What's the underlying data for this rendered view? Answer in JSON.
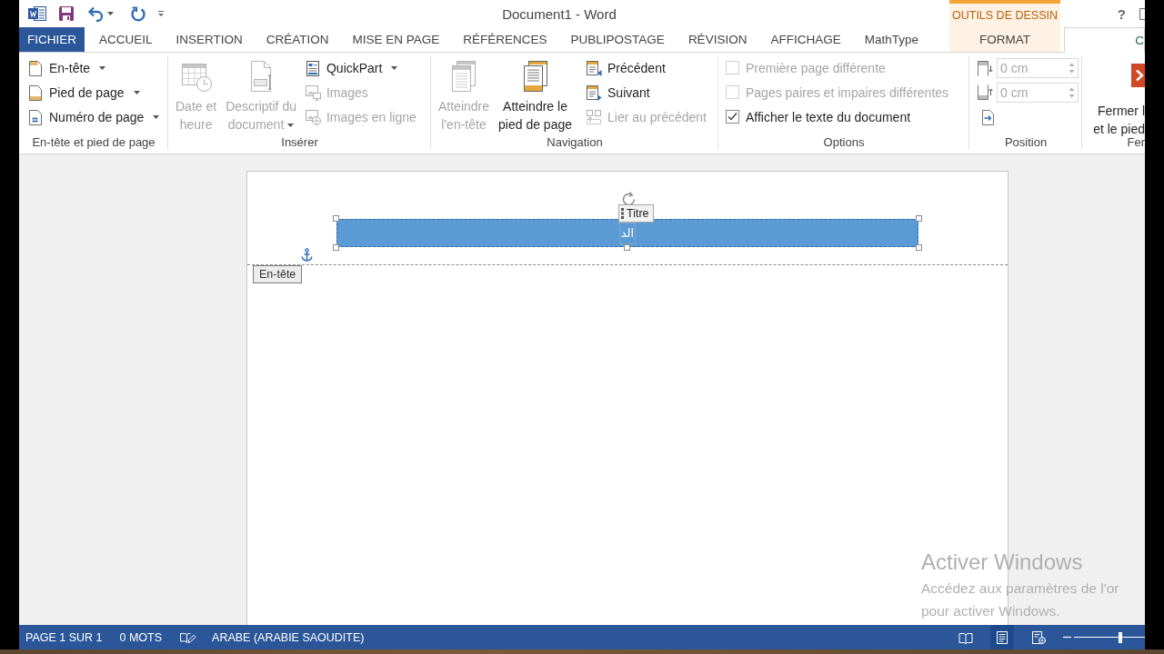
{
  "window": {
    "title": "Document1 - Word",
    "help": "?"
  },
  "contextual_group": {
    "label": "OUTILS DE DESSIN"
  },
  "tabs": [
    {
      "label": "FICHIER",
      "kind": "file",
      "selected": false
    },
    {
      "label": "ACCUEIL",
      "kind": "standard",
      "selected": false
    },
    {
      "label": "INSERTION",
      "kind": "standard",
      "selected": false
    },
    {
      "label": "CRÉATION",
      "kind": "standard",
      "selected": false
    },
    {
      "label": "MISE EN PAGE",
      "kind": "standard",
      "selected": false
    },
    {
      "label": "RÉFÉRENCES",
      "kind": "standard",
      "selected": false
    },
    {
      "label": "PUBLIPOSTAGE",
      "kind": "standard",
      "selected": false
    },
    {
      "label": "RÉVISION",
      "kind": "standard",
      "selected": false
    },
    {
      "label": "AFFICHAGE",
      "kind": "standard",
      "selected": false
    },
    {
      "label": "MathType",
      "kind": "standard",
      "selected": false
    },
    {
      "label": "FORMAT",
      "kind": "contextual",
      "selected": false
    },
    {
      "label": "C",
      "kind": "contextual",
      "selected": true
    }
  ],
  "ribbon": {
    "groups": [
      {
        "label": "En-tête et pied de page",
        "items": [
          {
            "kind": "small",
            "label": "En-tête",
            "dropdown": true,
            "disabled": false
          },
          {
            "kind": "small",
            "label": "Pied de page",
            "dropdown": true,
            "disabled": false
          },
          {
            "kind": "small",
            "label": "Numéro de page",
            "dropdown": true,
            "disabled": false
          }
        ]
      },
      {
        "label": "Insérer",
        "items": [
          {
            "kind": "large",
            "label": "Date et\nheure",
            "dropdown": false,
            "disabled": true
          },
          {
            "kind": "large",
            "label": "Descriptif du\ndocument",
            "dropdown": true,
            "disabled": true
          },
          {
            "kind": "small",
            "label": "QuickPart",
            "dropdown": true,
            "disabled": false
          },
          {
            "kind": "small",
            "label": "Images",
            "dropdown": false,
            "disabled": true
          },
          {
            "kind": "small",
            "label": "Images en ligne",
            "dropdown": false,
            "disabled": true
          }
        ]
      },
      {
        "label": "Navigation",
        "items": [
          {
            "kind": "large",
            "label": "Atteindre\nl'en-tête",
            "dropdown": false,
            "disabled": true
          },
          {
            "kind": "large",
            "label": "Atteindre le\npied de page",
            "dropdown": false,
            "disabled": false
          },
          {
            "kind": "small",
            "label": "Précédent",
            "dropdown": false,
            "disabled": false
          },
          {
            "kind": "small",
            "label": "Suivant",
            "dropdown": false,
            "disabled": false
          },
          {
            "kind": "small",
            "label": "Lier au précédent",
            "dropdown": false,
            "disabled": true
          }
        ]
      },
      {
        "label": "Options",
        "items": [
          {
            "kind": "checkbox",
            "label": "Première page différente",
            "checked": false,
            "disabled": true
          },
          {
            "kind": "checkbox",
            "label": "Pages paires et impaires différentes",
            "checked": false,
            "disabled": true
          },
          {
            "kind": "checkbox",
            "label": "Afficher le texte du document",
            "checked": true,
            "disabled": false
          }
        ]
      },
      {
        "label": "Position",
        "items": [
          {
            "kind": "spinner",
            "value": "0 cm",
            "disabled": true
          },
          {
            "kind": "spinner",
            "value": "0 cm",
            "disabled": true
          },
          {
            "kind": "icon",
            "disabled": false
          }
        ]
      },
      {
        "label": "Fer",
        "items": [
          {
            "kind": "large",
            "label": "Fermer l\net le pied",
            "dropdown": false,
            "disabled": false
          }
        ]
      }
    ]
  },
  "document": {
    "header_tag": "En-tête",
    "content_control": {
      "tag": "Titre",
      "text": "الد"
    }
  },
  "activation_notice": {
    "title": "Activer Windows",
    "lines": [
      "Accédez aux paramètres de l'or",
      "pour activer Windows."
    ]
  },
  "status_bar": {
    "page": "PAGE 1 SUR 1",
    "words": "0 MOTS",
    "language": "ARABE (ARABIE SAOUDITE)",
    "views": [
      {
        "selected": false
      },
      {
        "selected": true
      },
      {
        "selected": false
      }
    ],
    "zoom": {
      "level": 0.66
    }
  }
}
